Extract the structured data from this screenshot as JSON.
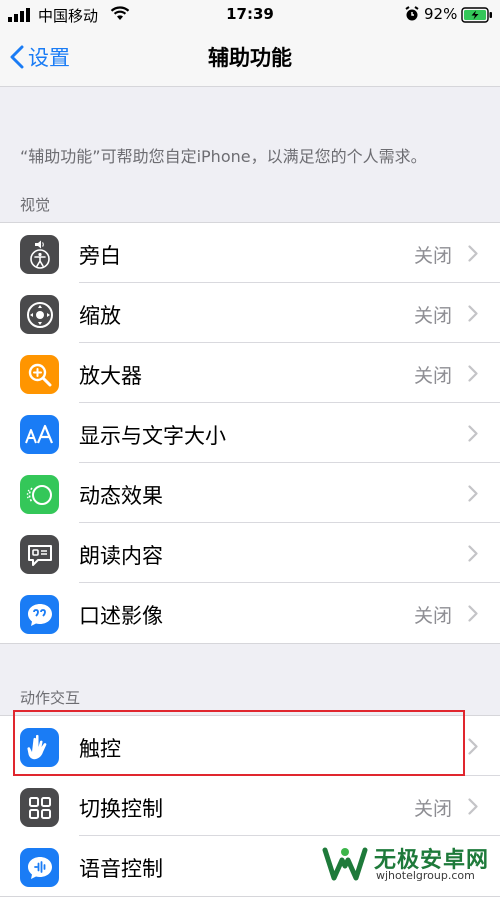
{
  "status": {
    "carrier": "中国移动",
    "time": "17:39",
    "battery_pct": "92%"
  },
  "nav": {
    "back_label": "设置",
    "title": "辅助功能"
  },
  "description": "“辅助功能”可帮助您自定iPhone，以满足您的个人需求。",
  "sections": {
    "vision_label": "视觉",
    "interaction_label": "动作交互"
  },
  "vision_items": [
    {
      "label": "旁白",
      "value": "关闭",
      "icon": "voiceover-icon",
      "color": "#4a4a4c"
    },
    {
      "label": "缩放",
      "value": "关闭",
      "icon": "zoom-icon",
      "color": "#4a4a4c"
    },
    {
      "label": "放大器",
      "value": "关闭",
      "icon": "magnifier-icon",
      "color": "#ff9500"
    },
    {
      "label": "显示与文字大小",
      "value": "",
      "icon": "text-size-icon",
      "color": "#1a7cf5"
    },
    {
      "label": "动态效果",
      "value": "",
      "icon": "motion-icon",
      "color": "#34c759"
    },
    {
      "label": "朗读内容",
      "value": "",
      "icon": "spoken-content-icon",
      "color": "#4a4a4c"
    },
    {
      "label": "口述影像",
      "value": "关闭",
      "icon": "audio-description-icon",
      "color": "#1a7cf5"
    }
  ],
  "interaction_items": [
    {
      "label": "触控",
      "value": "",
      "icon": "touch-icon",
      "color": "#1a7cf5"
    },
    {
      "label": "切换控制",
      "value": "关闭",
      "icon": "switch-control-icon",
      "color": "#4a4a4c"
    },
    {
      "label": "语音控制",
      "value": "",
      "icon": "voice-control-icon",
      "color": "#1a7cf5"
    }
  ],
  "watermark": {
    "title": "无极安卓网",
    "url": "wjhotelgroup.com",
    "color": "#1e7a3a"
  }
}
